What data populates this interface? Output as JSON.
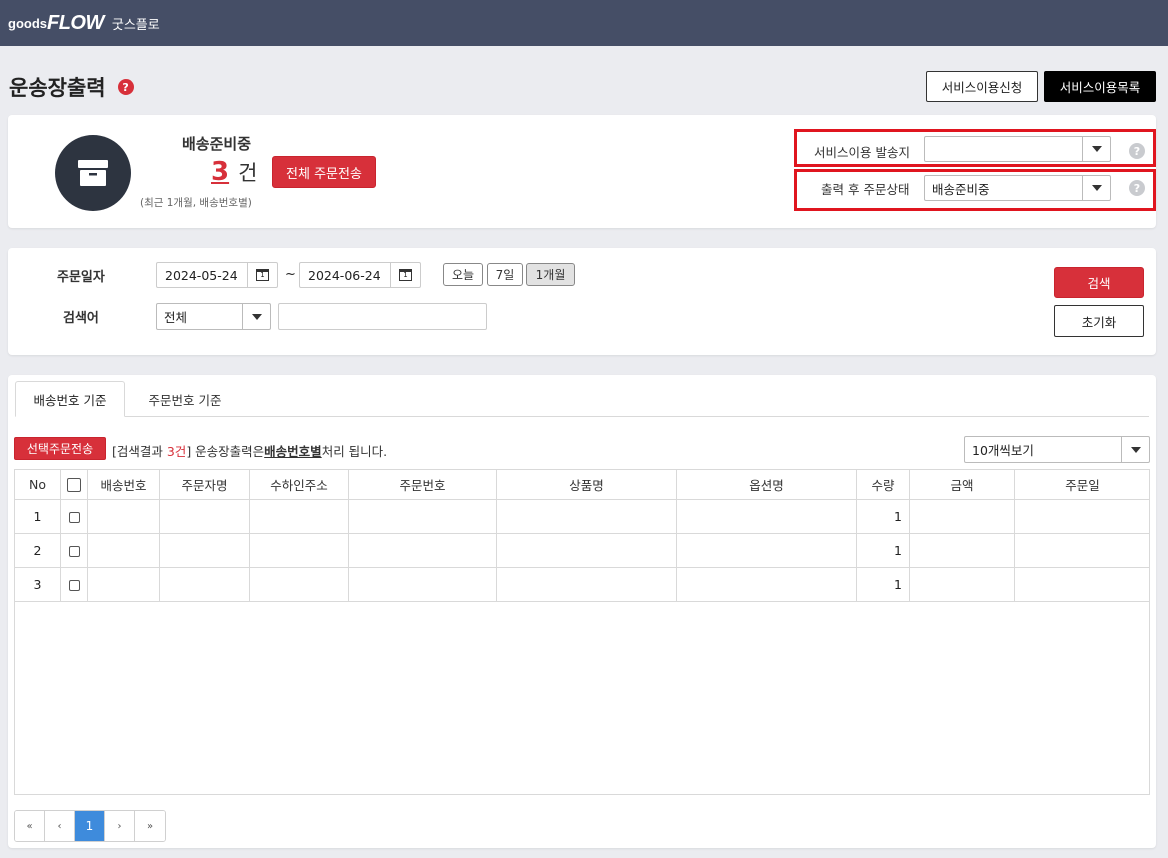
{
  "header": {
    "logo_goods": "goods",
    "logo_flow": "FLOW",
    "logo_ko": "굿스플로"
  },
  "page": {
    "title": "운송장출력",
    "help": "?"
  },
  "top_buttons": {
    "apply": "서비스이용신청",
    "list": "서비스이용목록"
  },
  "summary": {
    "status_label": "배송준비중",
    "count": "3",
    "count_unit": "건",
    "note": "(최근 1개월, 배송번호별)",
    "send_all_label": "전체 주문전송"
  },
  "settings": {
    "origin_label": "서비스이용 발송지",
    "origin_value": "",
    "after_status_label": "출력 후 주문상태",
    "after_status_value": "배송준비중",
    "help": "?"
  },
  "search": {
    "date_label": "주문일자",
    "date_from": "2024-05-24",
    "date_to": "2024-06-24",
    "tilde": "~",
    "quick": [
      "오늘",
      "7일",
      "1개월"
    ],
    "keyword_label": "검색어",
    "keyword_type": "전체",
    "keyword_value": "",
    "search_btn": "검색",
    "reset_btn": "초기화"
  },
  "tabs": [
    "배송번호 기준",
    "주문번호 기준"
  ],
  "result": {
    "send_selected_label": "선택주문전송",
    "prefix": "[검색결과 ",
    "count": "3건",
    "suffix": "] 운송장출력은",
    "bold": "배송번호별",
    "tail": "처리 됩니다.",
    "page_size": "10개씩보기"
  },
  "table": {
    "headers": [
      "No",
      "",
      "배송번호",
      "주문자명",
      "수하인주소",
      "주문번호",
      "상품명",
      "옵션명",
      "수량",
      "금액",
      "주문일"
    ],
    "rows": [
      {
        "no": "1",
        "qty": "1"
      },
      {
        "no": "2",
        "qty": "1"
      },
      {
        "no": "3",
        "qty": "1"
      }
    ]
  },
  "pagination": {
    "first": "«",
    "prev": "‹",
    "current": "1",
    "next": "›",
    "last": "»"
  },
  "colors": {
    "topbar": "#454e66",
    "accent_red": "#d7303a",
    "page_active": "#3e8bdc"
  }
}
